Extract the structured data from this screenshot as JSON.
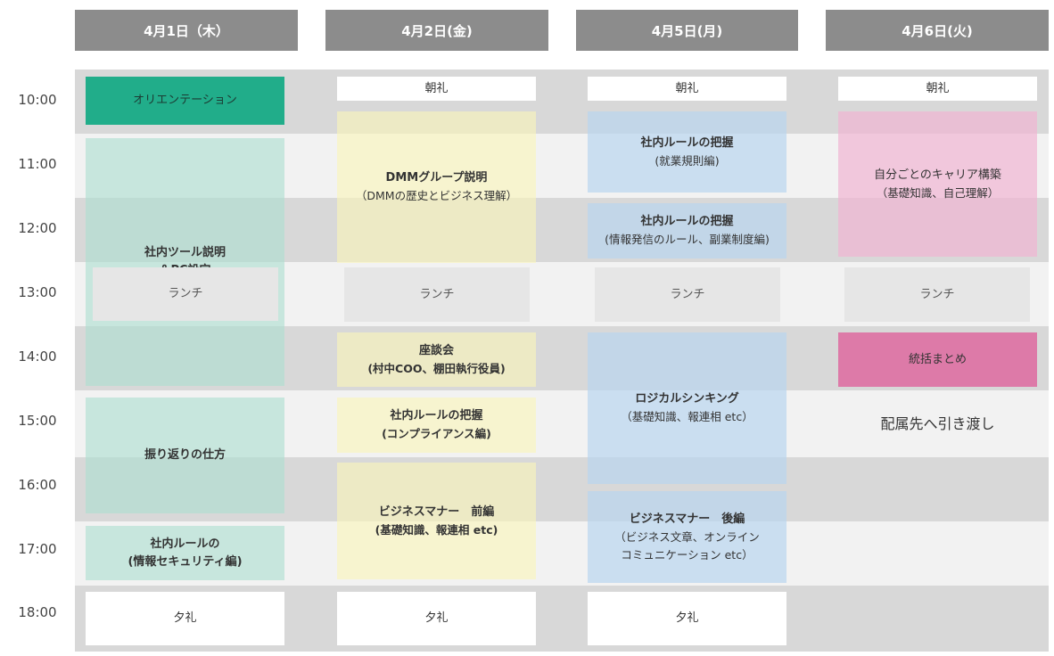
{
  "days": [
    {
      "label": "4月1日（木）"
    },
    {
      "label": "4月2日(金)"
    },
    {
      "label": "4月5日(月)"
    },
    {
      "label": "4月6日(火)"
    }
  ],
  "times": [
    "10:00",
    "11:00",
    "12:00",
    "13:00",
    "14:00",
    "15:00",
    "16:00",
    "17:00",
    "18:00"
  ],
  "day1": {
    "orientation": {
      "title": "オリエンテーション"
    },
    "tools": {
      "title": "社内ツール説明\n＆PC設定"
    },
    "lunch": {
      "title": "ランチ"
    },
    "reflection": {
      "title": "振り返りの仕方"
    },
    "security": {
      "title": "社内ルールの\n(情報セキュリティ編)"
    },
    "evening": {
      "title": "夕礼"
    }
  },
  "day2": {
    "morning": {
      "title": "朝礼"
    },
    "dmm": {
      "title": "DMMグループ説明",
      "sub": "（DMMの歴史とビジネス理解）"
    },
    "lunch": {
      "title": "ランチ"
    },
    "talk": {
      "title": "座談会",
      "sub": "(村中COO、棚田執行役員)"
    },
    "compliance": {
      "title": "社内ルールの把握",
      "sub": "(コンプライアンス編)"
    },
    "manner": {
      "title": "ビジネスマナー　前編",
      "sub": "(基礎知識、報連相 etc)"
    },
    "evening": {
      "title": "夕礼"
    }
  },
  "day3": {
    "morning": {
      "title": "朝礼"
    },
    "rules1": {
      "title": "社内ルールの把握",
      "sub": "(就業規則編)"
    },
    "rules2": {
      "title": "社内ルールの把握",
      "sub": "(情報発信のルール、副業制度編)"
    },
    "lunch": {
      "title": "ランチ"
    },
    "logical": {
      "title": "ロジカルシンキング",
      "sub": "（基礎知識、報連相 etc）"
    },
    "manner2": {
      "title": "ビジネスマナー　後編",
      "sub": "（ビジネス文章、オンライン\nコミュニケーション etc）"
    },
    "evening": {
      "title": "夕礼"
    }
  },
  "day4": {
    "morning": {
      "title": "朝礼"
    },
    "career": {
      "title": "自分ごとのキャリア構築",
      "sub": "（基礎知識、自己理解）"
    },
    "lunch": {
      "title": "ランチ"
    },
    "summary": {
      "title": "統括まとめ"
    },
    "handoff": {
      "title": "配属先へ引き渡し"
    }
  },
  "colors": {
    "header": "#8c8c8c",
    "orientation": "#21ad8a",
    "mint": "#acded0",
    "yellow": "#f9f5bc",
    "blue": "#bad6ee",
    "pink": "#f0b2d2",
    "summary": "#dd7aa8"
  }
}
